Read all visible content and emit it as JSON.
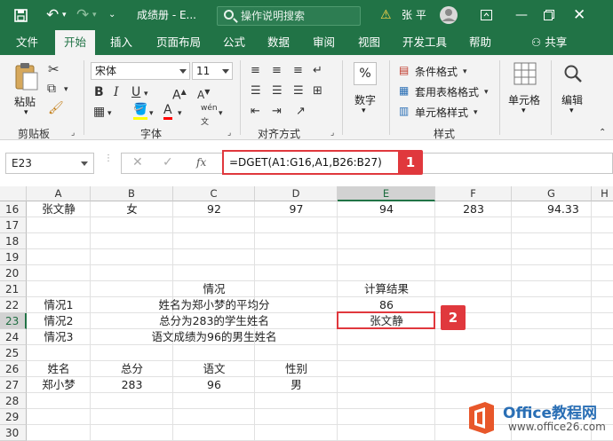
{
  "title_bar": {
    "doc_name": "成绩册 - E...",
    "search_placeholder": "操作说明搜索",
    "user_name": "张 平"
  },
  "tabs": [
    {
      "label": "文件"
    },
    {
      "label": "开始",
      "active": true
    },
    {
      "label": "插入"
    },
    {
      "label": "页面布局"
    },
    {
      "label": "公式"
    },
    {
      "label": "数据"
    },
    {
      "label": "审阅"
    },
    {
      "label": "视图"
    },
    {
      "label": "开发工具"
    },
    {
      "label": "帮助"
    }
  ],
  "share_label": "共享",
  "ribbon": {
    "clipboard": {
      "label": "剪贴板",
      "paste": "粘贴"
    },
    "font": {
      "label": "字体",
      "name": "宋体",
      "size": "11",
      "phonetic": "wén"
    },
    "alignment": {
      "label": "对齐方式"
    },
    "number": {
      "label": "数字",
      "icon": "%"
    },
    "styles": {
      "label": "样式",
      "conditional": "条件格式",
      "table_format": "套用表格格式",
      "cell_styles": "单元格样式"
    },
    "cells": {
      "label": "单元格"
    },
    "editing": {
      "label": "编辑"
    }
  },
  "formula_bar": {
    "name_box": "E23",
    "formula": "=DGET(A1:G16,A1,B26:B27)",
    "badge1": "1",
    "badge2": "2"
  },
  "columns": [
    "A",
    "B",
    "C",
    "D",
    "E",
    "F",
    "G",
    "H"
  ],
  "rows": [
    {
      "num": "16",
      "cells": [
        {
          "col": "A",
          "text": "张文静"
        },
        {
          "col": "B",
          "text": "女"
        },
        {
          "col": "C",
          "text": "92"
        },
        {
          "col": "D",
          "text": "97"
        },
        {
          "col": "E",
          "text": "94"
        },
        {
          "col": "F",
          "text": "283"
        },
        {
          "col": "G",
          "text": "94.33"
        }
      ]
    },
    {
      "num": "17",
      "cells": []
    },
    {
      "num": "18",
      "cells": []
    },
    {
      "num": "19",
      "cells": []
    },
    {
      "num": "20",
      "cells": []
    },
    {
      "num": "21",
      "cells": [
        {
          "col": "BD",
          "text": "情况"
        },
        {
          "col": "E",
          "text": "计算结果"
        }
      ]
    },
    {
      "num": "22",
      "cells": [
        {
          "col": "A",
          "text": "情况1"
        },
        {
          "col": "BD",
          "text": "姓名为郑小梦的平均分"
        },
        {
          "col": "E",
          "text": "86"
        }
      ]
    },
    {
      "num": "23",
      "cells": [
        {
          "col": "A",
          "text": "情况2"
        },
        {
          "col": "BD",
          "text": "总分为283的学生姓名"
        },
        {
          "col": "E",
          "text": "张文静"
        }
      ]
    },
    {
      "num": "24",
      "cells": [
        {
          "col": "A",
          "text": "情况3"
        },
        {
          "col": "BD",
          "text": "语文成绩为96的男生姓名"
        }
      ]
    },
    {
      "num": "25",
      "cells": []
    },
    {
      "num": "26",
      "cells": [
        {
          "col": "A",
          "text": "姓名"
        },
        {
          "col": "B",
          "text": "总分"
        },
        {
          "col": "C",
          "text": "语文"
        },
        {
          "col": "D",
          "text": "性别"
        }
      ]
    },
    {
      "num": "27",
      "cells": [
        {
          "col": "A",
          "text": "郑小梦"
        },
        {
          "col": "B",
          "text": "283"
        },
        {
          "col": "C",
          "text": "96"
        },
        {
          "col": "D",
          "text": "男"
        }
      ]
    },
    {
      "num": "28",
      "cells": []
    },
    {
      "num": "29",
      "cells": []
    },
    {
      "num": "30",
      "cells": []
    }
  ],
  "watermark": {
    "brand": "Office教程网",
    "url": "www.office26.com"
  },
  "colors": {
    "excel_green": "#217346",
    "highlight_red": "#e0383d",
    "office_orange": "#e8572a"
  }
}
